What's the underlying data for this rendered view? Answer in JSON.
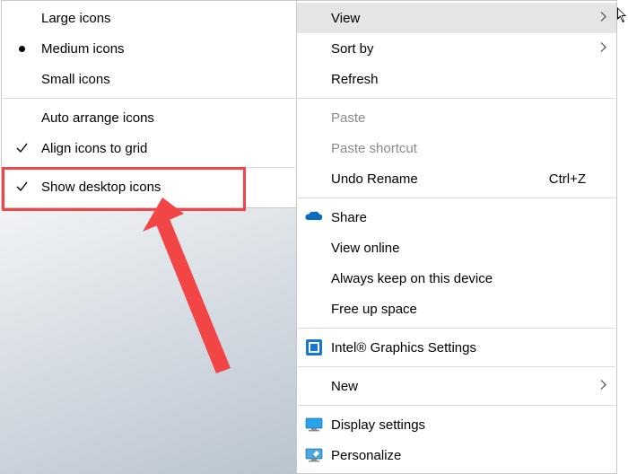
{
  "main_menu": {
    "view": {
      "label": "View"
    },
    "sort_by": {
      "label": "Sort by"
    },
    "refresh": {
      "label": "Refresh"
    },
    "paste": {
      "label": "Paste"
    },
    "paste_shortcut": {
      "label": "Paste shortcut"
    },
    "undo_rename": {
      "label": "Undo Rename",
      "accel": "Ctrl+Z"
    },
    "share": {
      "label": "Share"
    },
    "view_online": {
      "label": "View online"
    },
    "always_keep": {
      "label": "Always keep on this device"
    },
    "free_up": {
      "label": "Free up space"
    },
    "intel_gfx": {
      "label": "Intel® Graphics Settings"
    },
    "new": {
      "label": "New"
    },
    "display_settings": {
      "label": "Display settings"
    },
    "personalize": {
      "label": "Personalize"
    }
  },
  "view_submenu": {
    "large_icons": {
      "label": "Large icons"
    },
    "medium_icons": {
      "label": "Medium icons"
    },
    "small_icons": {
      "label": "Small icons"
    },
    "auto_arrange": {
      "label": "Auto arrange icons"
    },
    "align_grid": {
      "label": "Align icons to grid"
    },
    "show_desktop": {
      "label": "Show desktop icons"
    }
  }
}
